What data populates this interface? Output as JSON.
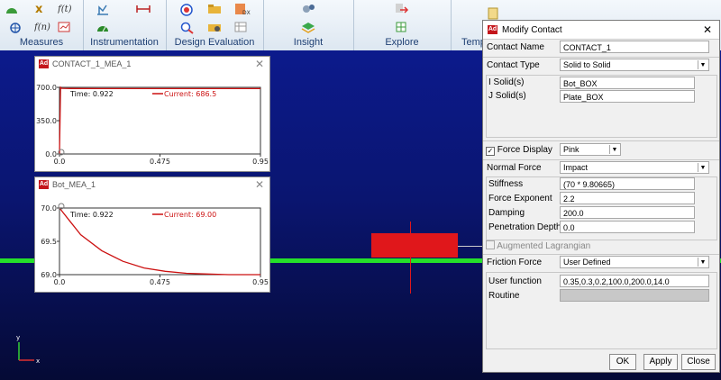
{
  "ribbon": {
    "groups": [
      "Measures",
      "Instrumentation",
      "Design Evaluation",
      "Insight",
      "Explore",
      "Tempo"
    ]
  },
  "plots": [
    {
      "title": "CONTACT_1_MEA_1",
      "time_label": "Time:  0.922",
      "legend_label": "Current:  686.5",
      "y_ticks": [
        "700.0",
        "350.0",
        "0.0"
      ],
      "x_ticks": [
        "0.0",
        "0.475",
        "0.95"
      ]
    },
    {
      "title": "Bot_MEA_1",
      "time_label": "Time:  0.922",
      "legend_label": "Current:  69.00",
      "y_ticks": [
        "70.0",
        "69.5",
        "69.0"
      ],
      "x_ticks": [
        "0.0",
        "0.475",
        "0.95"
      ]
    }
  ],
  "chart_data": [
    {
      "type": "line",
      "title": "CONTACT_1_MEA_1",
      "x": [
        0,
        0.005,
        0.01,
        0.05,
        0.2,
        0.475,
        0.7,
        0.95
      ],
      "y": [
        0,
        700,
        690,
        688,
        687,
        687,
        686.7,
        686.5
      ],
      "xlim": [
        0,
        0.95
      ],
      "ylim": [
        0,
        700
      ],
      "color": "#cc1111"
    },
    {
      "type": "line",
      "title": "Bot_MEA_1",
      "x": [
        0,
        0.05,
        0.1,
        0.2,
        0.3,
        0.4,
        0.5,
        0.6,
        0.7,
        0.8,
        0.95
      ],
      "y": [
        70.0,
        69.8,
        69.6,
        69.36,
        69.2,
        69.1,
        69.05,
        69.02,
        69.01,
        69.0,
        69.0
      ],
      "xlim": [
        0,
        0.95
      ],
      "ylim": [
        69.0,
        70.0
      ],
      "color": "#cc1111"
    }
  ],
  "dialog": {
    "title": "Modify Contact",
    "contact_name_label": "Contact Name",
    "contact_name_value": "CONTACT_1",
    "contact_type_label": "Contact Type",
    "contact_type_value": "Solid to Solid",
    "i_solid_label": "I Solid(s)",
    "i_solid_value": "Bot_BOX",
    "j_solid_label": "J Solid(s)",
    "j_solid_value": "Plate_BOX",
    "force_display_label": "Force Display",
    "force_display_value": "Pink",
    "normal_force_label": "Normal Force",
    "normal_force_value": "Impact",
    "stiffness_label": "Stiffness",
    "stiffness_value": "(70 * 9.80665)",
    "force_exponent_label": "Force Exponent",
    "force_exponent_value": "2.2",
    "damping_label": "Damping",
    "damping_value": "200.0",
    "penetration_label": "Penetration Depth",
    "penetration_value": "0.0",
    "augmented_label": "Augmented Lagrangian",
    "friction_force_label": "Friction Force",
    "friction_force_value": "User Defined",
    "user_function_label": "User function",
    "user_function_value": "0.35,0.3,0.2,100.0,200.0,14.0",
    "routine_label": "Routine",
    "routine_value": "",
    "ok_label": "OK",
    "apply_label": "Apply",
    "close_label": "Close"
  },
  "axes_triad": {
    "y": "y",
    "x": "x"
  },
  "window_close_glyph": "✕",
  "adams_icon_text": "Ad"
}
